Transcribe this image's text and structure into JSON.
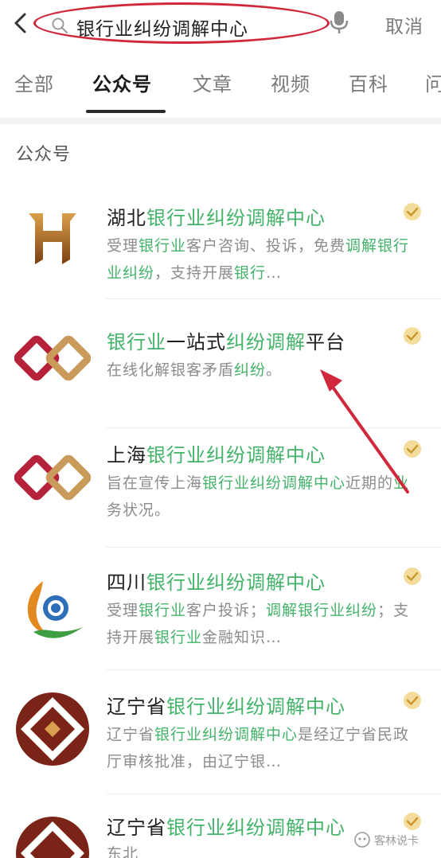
{
  "search": {
    "query": "银行业纠纷调解中心",
    "cancel_label": "取消"
  },
  "tabs": [
    {
      "label": "全部"
    },
    {
      "label": "公众号"
    },
    {
      "label": "文章"
    },
    {
      "label": "视频"
    },
    {
      "label": "百科"
    },
    {
      "label": "问"
    }
  ],
  "active_tab": "公众号",
  "section_title": "公众号",
  "results": [
    {
      "title_parts": [
        "湖北",
        "银行业纠纷调解中心"
      ],
      "title_highlight": [
        false,
        true
      ],
      "desc_parts": [
        "受理",
        "银行业",
        "客户咨询、投诉，免费",
        "调解银行业纠纷",
        "，支持开展",
        "银行",
        "…"
      ],
      "desc_highlight": [
        false,
        true,
        false,
        true,
        false,
        true,
        false
      ]
    },
    {
      "title_parts": [
        "银行业",
        "一站式",
        "纠纷调解",
        "平台"
      ],
      "title_highlight": [
        true,
        false,
        true,
        false
      ],
      "desc_parts": [
        "在线化解银客矛盾",
        "纠纷",
        "。"
      ],
      "desc_highlight": [
        false,
        true,
        false
      ]
    },
    {
      "title_parts": [
        "上海",
        "银行业纠纷调解中心"
      ],
      "title_highlight": [
        false,
        true
      ],
      "desc_parts": [
        "旨在宣传上海",
        "银行业纠纷调解中心",
        "近期的",
        "业",
        "务状况。"
      ],
      "desc_highlight": [
        false,
        true,
        false,
        true,
        false
      ]
    },
    {
      "title_parts": [
        "四川",
        "银行业纠纷调解中心"
      ],
      "title_highlight": [
        false,
        true
      ],
      "desc_parts": [
        "受理",
        "银行业",
        "客户投诉；",
        "调解银行业纠纷",
        "；支持开展",
        "银行业",
        "金融知识…"
      ],
      "desc_highlight": [
        false,
        true,
        false,
        true,
        false,
        true,
        false
      ]
    },
    {
      "title_parts": [
        "辽宁省",
        "银行业纠纷调解中心"
      ],
      "title_highlight": [
        false,
        true
      ],
      "desc_parts": [
        "辽宁省",
        "银行业纠纷调解中心",
        "是经辽宁省民政厅审核批准，由辽宁银…"
      ],
      "desc_highlight": [
        false,
        true,
        false
      ]
    },
    {
      "title_parts": [
        "辽宁省",
        "银行业纠纷调解中心"
      ],
      "title_highlight": [
        false,
        true
      ],
      "desc_parts": [
        "东北"
      ],
      "desc_highlight": [
        false
      ]
    }
  ],
  "watermark": "客林说卡",
  "colors": {
    "highlight": "#43b36a",
    "annotation": "#d0283a",
    "verified": "#e9c36a"
  },
  "icons": {
    "back": "chevron-left-icon",
    "search": "search-icon",
    "mic": "microphone-icon",
    "verified": "verified-badge-icon"
  }
}
